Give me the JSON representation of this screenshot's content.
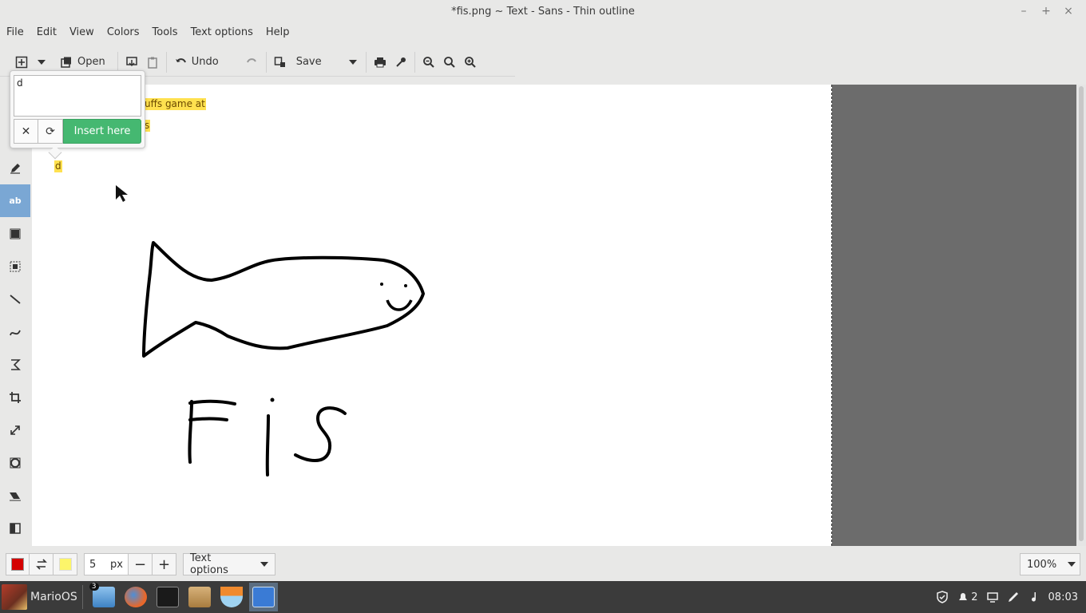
{
  "window": {
    "title": "*fis.png ~ Text - Sans - Thin outline",
    "controls": [
      "–",
      "+",
      "×"
    ]
  },
  "menubar": [
    "File",
    "Edit",
    "View",
    "Colors",
    "Tools",
    "Text options",
    "Help"
  ],
  "toolbar": {
    "open_label": "Open",
    "undo_label": "Undo",
    "save_label": "Save"
  },
  "canvas": {
    "text_fragments": [
      "uffs game at",
      "s",
      "d"
    ],
    "drawing_text": "Fis"
  },
  "text_popover": {
    "input_value": "d",
    "insert_label": "Insert here"
  },
  "bottombar": {
    "main_color": "#d40000",
    "secondary_color": "#fcf56a",
    "size_value": "5",
    "size_unit": "px",
    "options_label": "Text options",
    "zoom_label": "100%"
  },
  "taskbar": {
    "start_label": "MarioOS",
    "files_badge": "3",
    "tray_notif_count": "2",
    "clock": "08:03"
  }
}
